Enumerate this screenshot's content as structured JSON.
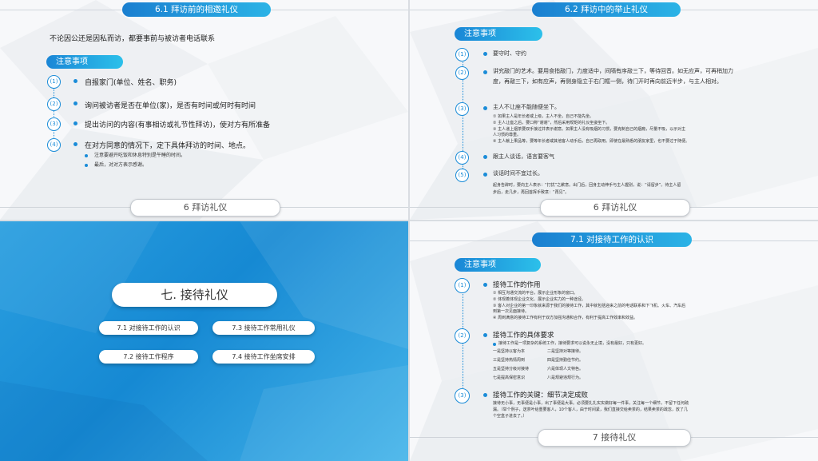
{
  "s1": {
    "header": "6.1 拜访前的相邀礼仪",
    "intro": "不论因公还是因私而访，都要事前与被访者电话联系",
    "section": "注意事项",
    "items": [
      {
        "n": "(1)",
        "text": "自报家门(单位、姓名、职务)"
      },
      {
        "n": "(2)",
        "text": "询问被访者是否在单位(家)，是否有时间或何时有时间"
      },
      {
        "n": "(3)",
        "text": "提出访问的内容(有事相访或礼节性拜访)，使对方有所准备"
      },
      {
        "n": "(4)",
        "text": "在对方同意的情况下，定下具体拜访的时间、地点。"
      }
    ],
    "subs": [
      "注意要避开吃饭和休息特别是午睡的时间。",
      "最后，对对方表示感谢。"
    ],
    "footer": "6  拜访礼仪"
  },
  "s2": {
    "header": "6.2 拜访中的举止礼仪",
    "section": "注意事项",
    "i1": {
      "n": "(1)",
      "text": "要守时、守约"
    },
    "i2": {
      "n": "(2)",
      "l1": "讲究敲门的艺术。要用食指敲门，力度适中，间隔有序敲三下，等待回音。如无应声，可再稍加力",
      "l2": "度，再敲三下，如有应声，再侧身隐立于右门框一侧，待门开时再向前迈半步，与主人相对。"
    },
    "i3": {
      "n": "(3)",
      "text": "主人不让座不能随便坐下。",
      "d1": "①  如果主人是年长者或上级，主人不坐，自己不能先坐。",
      "d2": "②  主人让座之后，要口称“谢谢”，然后采用规矩的礼仪坐姿坐下。",
      "d3a": "③  主人递上烟茶要双手接过并表示谢意。如果主人没有吸烟的习惯，要克制自己的烟瘾，尽量不吸，以示对主",
      "d3b": "     人习惯的尊重。",
      "d4": "④  主人献上果品等，要等年长者或其他客人动手后，自己再取用。即使在最熟悉的朋友家里，也不要过于随便。"
    },
    "i4": {
      "n": "(4)",
      "text": "跟主人谈话，语言要客气"
    },
    "i5": {
      "n": "(5)",
      "text": "谈话时间不宜过长。",
      "p1": "起身告辞时，要向主人表示：“打扰”之歉意。出门后，回身主动伸手与主人握别，说：“请留步”。待主人留",
      "p2": "步后，走几步，再回首挥手致意：“再见”。"
    },
    "footer": "6  拜访礼仪"
  },
  "s3": {
    "title": "七. 接待礼仪",
    "links": [
      "7.1   对接待工作的认识",
      "7.3  接待工作常用礼仪",
      "7.2   接待工作程序",
      "7.4  接待工作坐席安排"
    ]
  },
  "s4": {
    "header": "7.1 对接待工作的认识",
    "section": "注意事项",
    "i1": {
      "n": "(1)",
      "title": "接待工作的作用",
      "d": [
        "①  相互沟通交流的平台，展示企业形象的窗口。",
        "②  体现着体现企业文化、展示企业实力的一种途径。",
        "③  客人对企业的第一印象就来源于我们的接待工作，其中就包括迎来之前的电话联系和下飞机、火车、汽车后",
        "     到第一次见面接待。",
        "④  周到满意的接待工作有利于双方加强沟通和合作，有利于提高工作效率和效益。"
      ]
    },
    "i2": {
      "n": "(2)",
      "title": "接待工作的具体要求",
      "lead": "接待工作是一项复杂的系统工作，接待要求可以说永无止境，没有最好，只有更好。",
      "grid": [
        [
          "一是坚持以客为本",
          "二是坚持对等接待。"
        ],
        [
          "三是坚持热情周到",
          "四是坚持勤俭节约。"
        ],
        [
          "五是坚持分级对接待",
          "六是体现人文特色。"
        ],
        [
          "七是提高保密意识",
          "八是规避违规行为。"
        ]
      ]
    },
    "i3": {
      "n": "(3)",
      "title": "接待工作的关键：细节决定成败",
      "p1": "接待无小事，无事便是小事，出了事便是大事。必须要扎扎实实做好每一件事，关注每一个细节，不留下任何疏",
      "p2": "漏。（举个例子，送茶叶给重要客人，10个客人，由于时间紧，我们直接交给卖茶的，结果卖茶的疏忽，放了几",
      "p3": "个空盒子进去了。）"
    },
    "footer": "7  接待礼仪"
  }
}
